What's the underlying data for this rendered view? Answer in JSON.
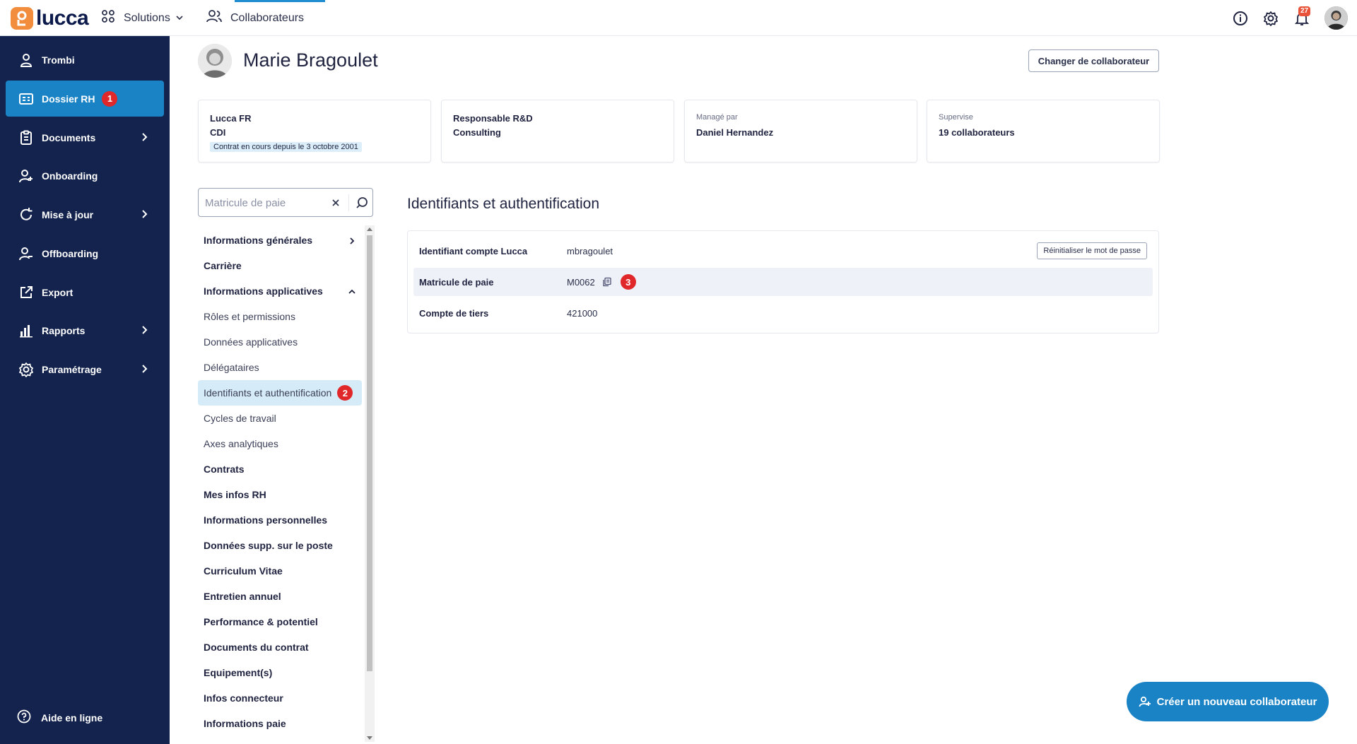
{
  "app": {
    "logo_text": "lucca",
    "brand_color": "#f28d3e",
    "accent_color": "#1a83c6"
  },
  "topbar": {
    "solutions_label": "Solutions",
    "collaborateurs_label": "Collaborateurs",
    "notifications_count": "27"
  },
  "sidebar": {
    "items": [
      {
        "label": "Trombi",
        "icon": "person-icon"
      },
      {
        "label": "Dossier RH",
        "icon": "id-card-icon",
        "badge": "1"
      },
      {
        "label": "Documents",
        "icon": "clipboard-icon"
      },
      {
        "label": "Onboarding",
        "icon": "person-add-icon"
      },
      {
        "label": "Mise à jour",
        "icon": "refresh-icon"
      },
      {
        "label": "Offboarding",
        "icon": "person-remove-icon"
      },
      {
        "label": "Export",
        "icon": "external-link-icon"
      },
      {
        "label": "Rapports",
        "icon": "bar-chart-icon"
      },
      {
        "label": "Paramétrage",
        "icon": "gear-icon"
      }
    ],
    "help_label": "Aide en ligne"
  },
  "profile": {
    "name": "Marie Bragoulet",
    "change_button": "Changer de collaborateur"
  },
  "cards": {
    "c1": {
      "line1": "Lucca FR",
      "line2": "CDI",
      "tag": "Contrat en cours depuis le 3 octobre 2001"
    },
    "c2": {
      "line1": "Responsable R&D",
      "line2": "Consulting"
    },
    "c3": {
      "caption": "Managé par",
      "value": "Daniel Hernandez"
    },
    "c4": {
      "caption": "Supervise",
      "value": "19 collaborateurs"
    }
  },
  "search": {
    "placeholder": "Matricule de paie"
  },
  "menu": {
    "items": [
      {
        "label": "Informations générales"
      },
      {
        "label": "Carrière"
      },
      {
        "label": "Informations applicatives"
      },
      {
        "label": "Rôles et permissions"
      },
      {
        "label": "Données applicatives"
      },
      {
        "label": "Délégataires"
      },
      {
        "label": "Identifiants et authentification",
        "badge": "2"
      },
      {
        "label": "Cycles de travail"
      },
      {
        "label": "Axes analytiques"
      },
      {
        "label": "Contrats"
      },
      {
        "label": "Mes infos RH"
      },
      {
        "label": "Informations personnelles"
      },
      {
        "label": "Données supp. sur le poste"
      },
      {
        "label": "Curriculum Vitae"
      },
      {
        "label": "Entretien annuel"
      },
      {
        "label": "Performance & potentiel"
      },
      {
        "label": "Documents du contrat"
      },
      {
        "label": "Equipement(s)"
      },
      {
        "label": "Infos connecteur"
      },
      {
        "label": "Informations paie"
      }
    ]
  },
  "section": {
    "title": "Identifiants et authentification",
    "rows": [
      {
        "key": "Identifiant compte Lucca",
        "value": "mbragoulet",
        "action": "Réinitialiser le mot de passe"
      },
      {
        "key": "Matricule de paie",
        "value": "M0062",
        "badge": "3"
      },
      {
        "key": "Compte de tiers",
        "value": "421000"
      }
    ]
  },
  "create_button": "Créer un nouveau collaborateur"
}
